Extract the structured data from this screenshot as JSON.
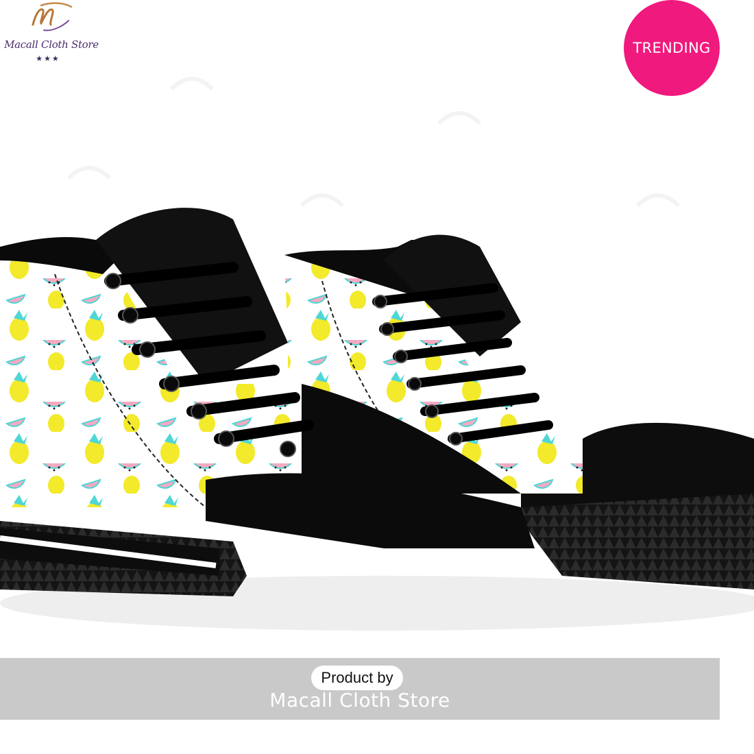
{
  "brand": {
    "logo_initials": "M",
    "name": "Macall Cloth Store",
    "stars": "★★★"
  },
  "badge": {
    "label": "TRENDING",
    "color": "#f0197d"
  },
  "product": {
    "description": "High-top sneakers with pineapple and watermelon pattern",
    "upper_colors": {
      "base": "#ffffff",
      "pineapple": "#f2ea2a",
      "watermelon": "#f4aac0",
      "leaf": "#4fd6d6",
      "trim": "#111111"
    }
  },
  "footer": {
    "product_by": "Product by",
    "store_name": "Macall Cloth Store"
  }
}
